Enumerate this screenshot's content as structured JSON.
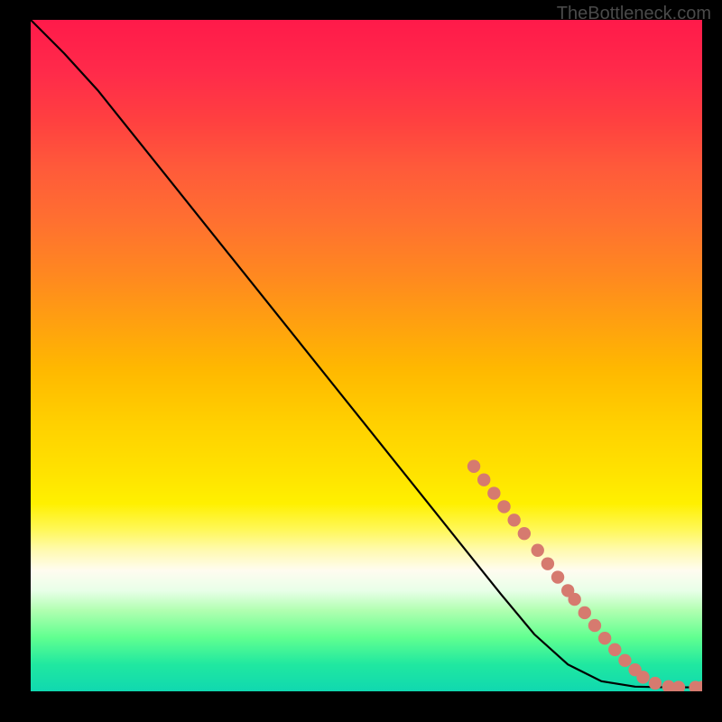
{
  "attribution": "TheBottleneck.com",
  "chart_data": {
    "type": "line",
    "title": "",
    "xlabel": "",
    "ylabel": "",
    "xlim": [
      0,
      100
    ],
    "ylim": [
      0,
      100
    ],
    "curve": [
      {
        "x": 0,
        "y": 100
      },
      {
        "x": 2,
        "y": 98
      },
      {
        "x": 5,
        "y": 95
      },
      {
        "x": 10,
        "y": 89.5
      },
      {
        "x": 20,
        "y": 77
      },
      {
        "x": 30,
        "y": 64.5
      },
      {
        "x": 40,
        "y": 52
      },
      {
        "x": 50,
        "y": 39.5
      },
      {
        "x": 60,
        "y": 27
      },
      {
        "x": 70,
        "y": 14.5
      },
      {
        "x": 75,
        "y": 8.5
      },
      {
        "x": 80,
        "y": 4
      },
      {
        "x": 85,
        "y": 1.5
      },
      {
        "x": 90,
        "y": 0.7
      },
      {
        "x": 95,
        "y": 0.6
      },
      {
        "x": 100,
        "y": 0.6
      }
    ],
    "markers": [
      {
        "x": 66,
        "y": 33.5
      },
      {
        "x": 67.5,
        "y": 31.5
      },
      {
        "x": 69,
        "y": 29.5
      },
      {
        "x": 70.5,
        "y": 27.5
      },
      {
        "x": 72,
        "y": 25.5
      },
      {
        "x": 73.5,
        "y": 23.5
      },
      {
        "x": 75.5,
        "y": 21
      },
      {
        "x": 77,
        "y": 19
      },
      {
        "x": 78.5,
        "y": 17
      },
      {
        "x": 80,
        "y": 15
      },
      {
        "x": 81,
        "y": 13.7
      },
      {
        "x": 82.5,
        "y": 11.7
      },
      {
        "x": 84,
        "y": 9.8
      },
      {
        "x": 85.5,
        "y": 7.9
      },
      {
        "x": 87,
        "y": 6.2
      },
      {
        "x": 88.5,
        "y": 4.6
      },
      {
        "x": 90,
        "y": 3.2
      },
      {
        "x": 91.2,
        "y": 2.1
      },
      {
        "x": 93,
        "y": 1.2
      },
      {
        "x": 95,
        "y": 0.7
      },
      {
        "x": 96.5,
        "y": 0.6
      },
      {
        "x": 99,
        "y": 0.6
      },
      {
        "x": 100,
        "y": 0.6
      }
    ],
    "marker_color": "#d67a6f",
    "curve_color": "#000000"
  }
}
